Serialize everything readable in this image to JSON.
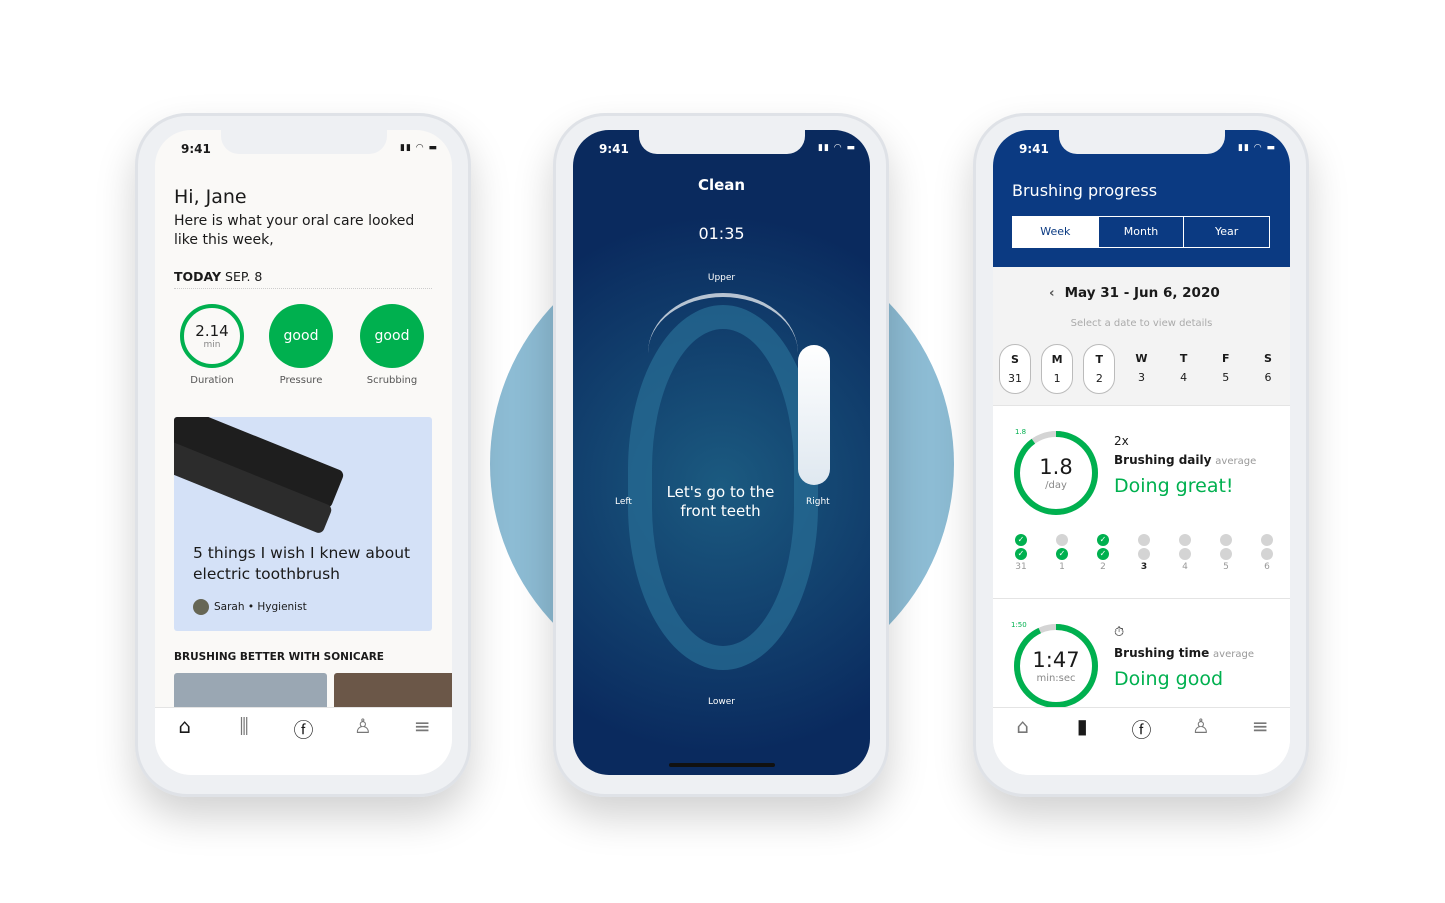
{
  "status": {
    "time": "9:41"
  },
  "home": {
    "greeting": "Hi, Jane",
    "subtitle": "Here is what your oral care looked like this week,",
    "today_label": "TODAY",
    "today_date": "SEP. 8",
    "metrics": [
      {
        "value": "2.14",
        "unit": "min",
        "label": "Duration"
      },
      {
        "value": "good",
        "label": "Pressure"
      },
      {
        "value": "good",
        "label": "Scrubbing"
      }
    ],
    "article": {
      "title": "5 things I wish I knew about electric toothbrush",
      "author": "Sarah • Hygienist"
    },
    "section_title": "BRUSHING BETTER WITH SONICARE"
  },
  "clean": {
    "title": "Clean",
    "timer": "01:35",
    "upper": "Upper",
    "lower": "Lower",
    "left": "Left",
    "right": "Right",
    "instruction": "Let's go to the front teeth"
  },
  "progress": {
    "title": "Brushing progress",
    "tabs": [
      "Week",
      "Month",
      "Year"
    ],
    "active_tab": "Week",
    "range": "May 31 - Jun 6, 2020",
    "hint": "Select a date to view details",
    "days": [
      {
        "d": "S",
        "n": "31"
      },
      {
        "d": "M",
        "n": "1"
      },
      {
        "d": "T",
        "n": "2"
      },
      {
        "d": "W",
        "n": "3"
      },
      {
        "d": "T",
        "n": "4"
      },
      {
        "d": "F",
        "n": "5"
      },
      {
        "d": "S",
        "n": "6"
      }
    ],
    "daily": {
      "goal_mark": "1.8",
      "value": "1.8",
      "unit": "/day",
      "count": "2x",
      "label": "Brushing daily",
      "qualifier": "average",
      "verdict": "Doing great!",
      "fraction": 0.9,
      "checks": [
        [
          true,
          true
        ],
        [
          false,
          true
        ],
        [
          true,
          true
        ],
        [
          false,
          false
        ],
        [
          false,
          false
        ],
        [
          false,
          false
        ],
        [
          false,
          false
        ]
      ]
    },
    "time": {
      "goal_mark": "1:50",
      "value": "1:47",
      "unit": "min:sec",
      "label": "Brushing time",
      "qualifier": "average",
      "verdict": "Doing good",
      "fraction": 0.93
    }
  },
  "colors": {
    "green": "#00b04f",
    "navy": "#0b3a82",
    "circle": "#8dbcd4"
  }
}
